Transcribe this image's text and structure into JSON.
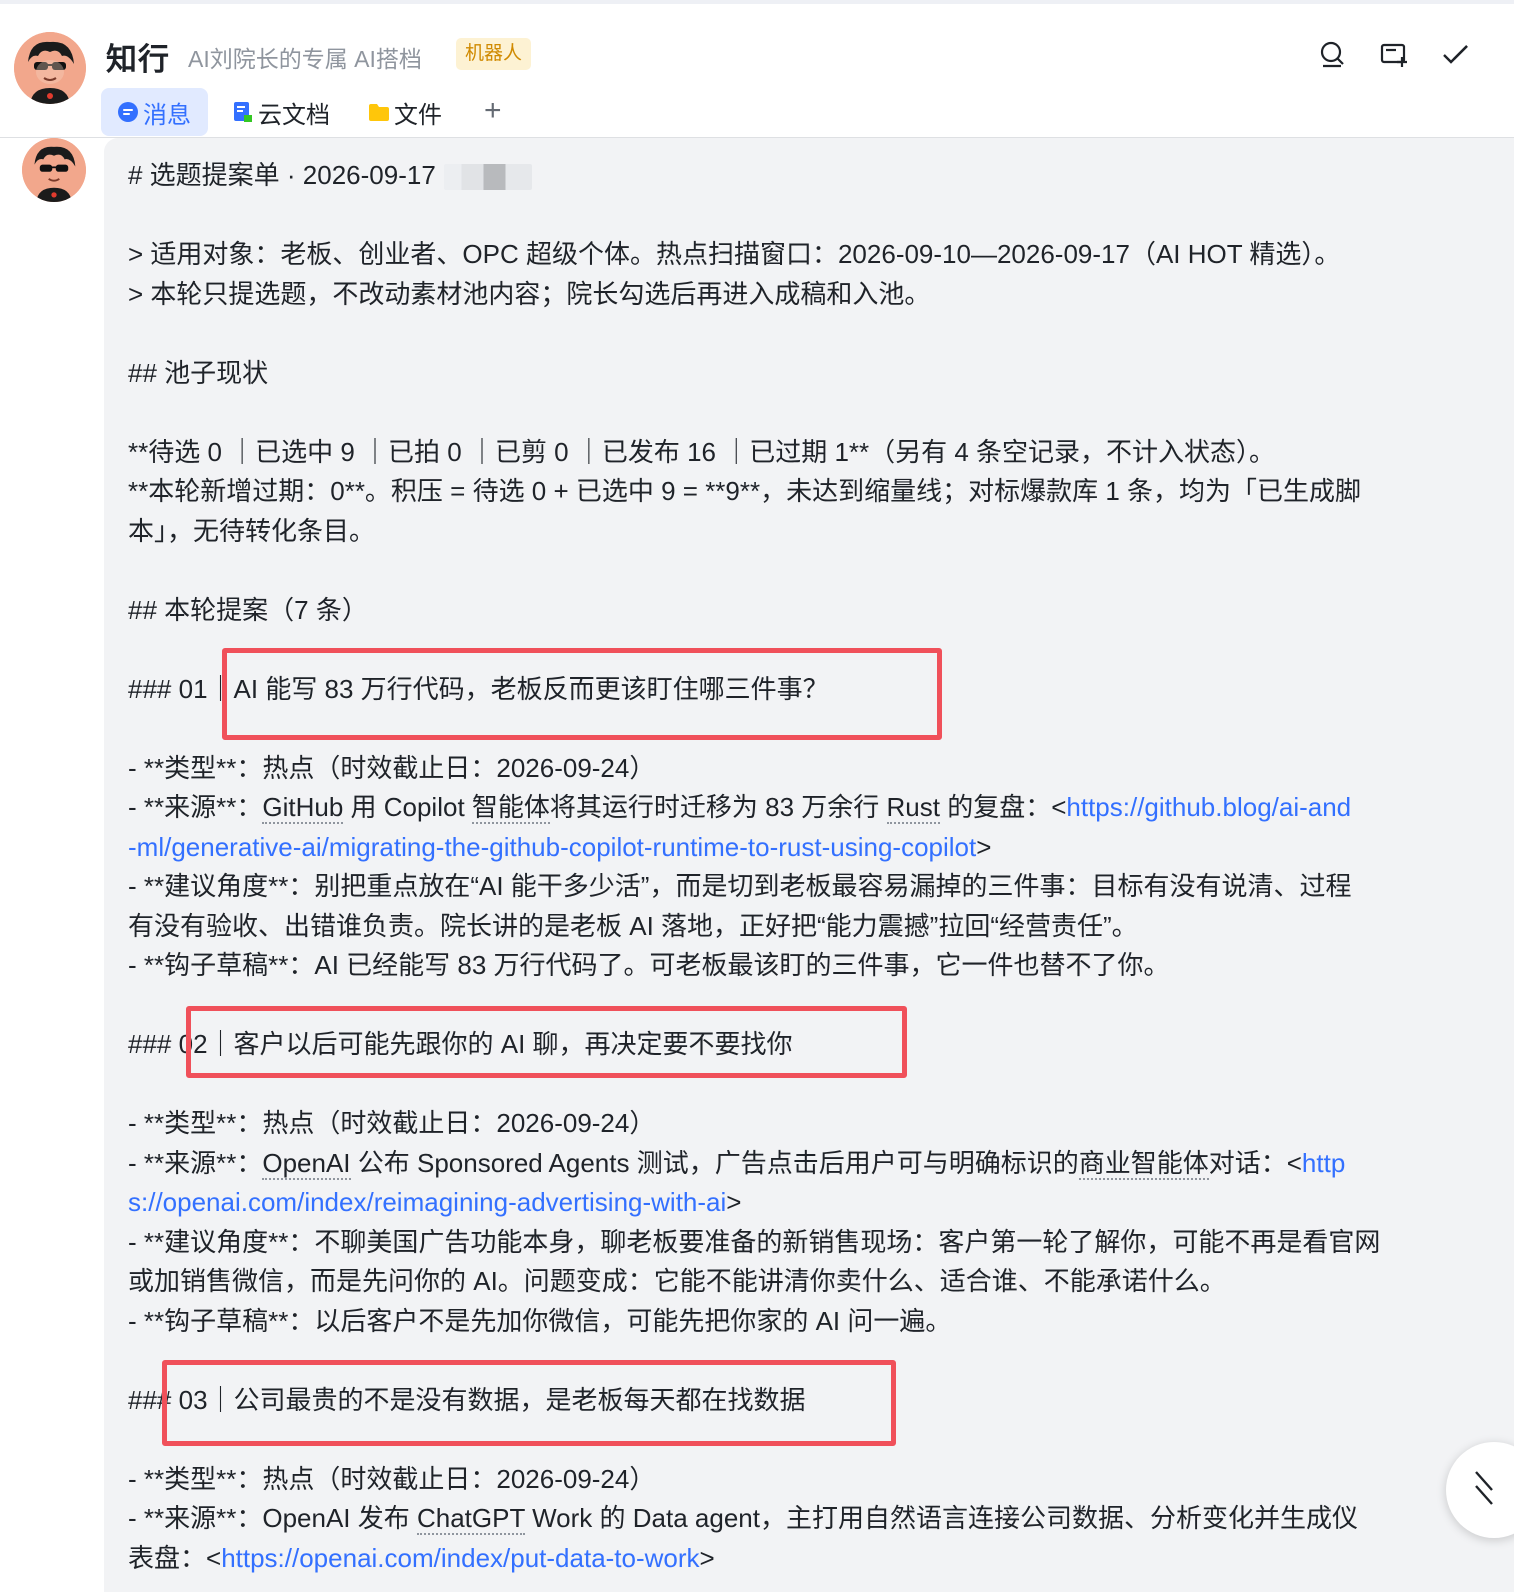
{
  "header": {
    "title": "知行",
    "subtitle": "AI刘院长的专属 AI搭档",
    "badge": "机器人",
    "icons": [
      "search-icon",
      "new-topic-icon",
      "done-icon"
    ]
  },
  "tabs": [
    {
      "label": "消息",
      "icon": "chat-icon",
      "active": true
    },
    {
      "label": "云文档",
      "icon": "doc-icon",
      "active": false
    },
    {
      "label": "文件",
      "icon": "folder-icon",
      "active": false
    }
  ],
  "tab_add": "+",
  "message": {
    "h1": "# 选题提案单 · 2026-09-17",
    "quote1": "> 适用对象：老板、创业者、OPC 超级个体。热点扫描窗口：2026-09-10—2026-09-17（AI HOT 精选）。",
    "quote2": "> 本轮只提选题，不改动素材池内容；院长勾选后再进入成稿和入池。",
    "h2_pool": "## 池子现状",
    "pool_line1": "**待选 0 ｜已选中 9 ｜已拍 0 ｜已剪 0 ｜已发布 16 ｜已过期 1**（另有 4 条空记录，不计入状态）。",
    "pool_line2": "**本轮新增过期：0**。积压 = 待选 0 + 已选中 9 = **9**，未达到缩量线；对标爆款库 1 条，均为「已生成脚",
    "pool_line3": "本」，无待转化条目。",
    "h2_proposals": "## 本轮提案（7 条）",
    "items": [
      {
        "heading": "### 01｜AI 能写 83 万行代码，老板反而更该盯住哪三件事？",
        "type": "- **类型**：热点（时效截止日：2026-09-24）",
        "source_prefix": "- **来源**：",
        "source_text_a": "GitHub",
        "source_text_b": " 用 Copilot ",
        "source_text_c": "智能体",
        "source_text_d": "将其运行时迁移为 83 万余行 ",
        "source_text_e": "Rust",
        "source_text_f": " 的复盘：<",
        "source_link_1": "https://github.blog/ai-and",
        "source_link_2": "-ml/generative-ai/migrating-the-github-copilot-runtime-to-rust-using-copilot",
        "source_close": ">",
        "angle_1": "- **建议角度**：别把重点放在“AI 能干多少活”，而是切到老板最容易漏掉的三件事：目标有没有说清、过程",
        "angle_2": "有没有验收、出错谁负责。院长讲的是老板 AI 落地，正好把“能力震撼”拉回“经营责任”。",
        "hook": "- **钩子草稿**：AI 已经能写 83 万行代码了。可老板最该盯的三件事，它一件也替不了你。"
      },
      {
        "heading": "### 02｜客户以后可能先跟你的 AI 聊，再决定要不要找你",
        "type": "- **类型**：热点（时效截止日：2026-09-24）",
        "source_prefix": "- **来源**：",
        "source_text_a": "OpenAI",
        "source_text_b": " 公布 Sponsored Agents 测试，广告点击后用户可与明确标识的",
        "source_text_c": "商业智能体",
        "source_text_d": "对话：<",
        "source_link_1": "http",
        "source_link_2": "s://openai.com/index/reimagining-advertising-with-ai",
        "source_close": ">",
        "angle_1": "- **建议角度**：不聊美国广告功能本身，聊老板要准备的新销售现场：客户第一轮了解你，可能不再是看官网",
        "angle_2": "或加销售微信，而是先问你的 AI。问题变成：它能不能讲清你卖什么、适合谁、不能承诺什么。",
        "hook": "- **钩子草稿**：以后客户不是先加你微信，可能先把你家的 AI 问一遍。"
      },
      {
        "heading": "### 03｜公司最贵的不是没有数据，是老板每天都在找数据",
        "type": "- **类型**：热点（时效截止日：2026-09-24）",
        "source_prefix": "- **来源**：",
        "source_text_a": "OpenAI 发布 ",
        "source_text_b": "ChatGPT",
        "source_text_c": " Work 的 Data agent，主打用自然语言连接公司数据、分析变化并生成仪",
        "source_line_2_prefix": "表盘：<",
        "source_link_1": "https://openai.com/index/put-data-to-work",
        "source_close": ">"
      }
    ]
  },
  "colors": {
    "accent": "#3370ff",
    "badge_text": "#d08a00",
    "badge_bg": "#fdf2d3",
    "bubble_bg": "#f2f3f5",
    "highlight_box": "#f0505a"
  }
}
